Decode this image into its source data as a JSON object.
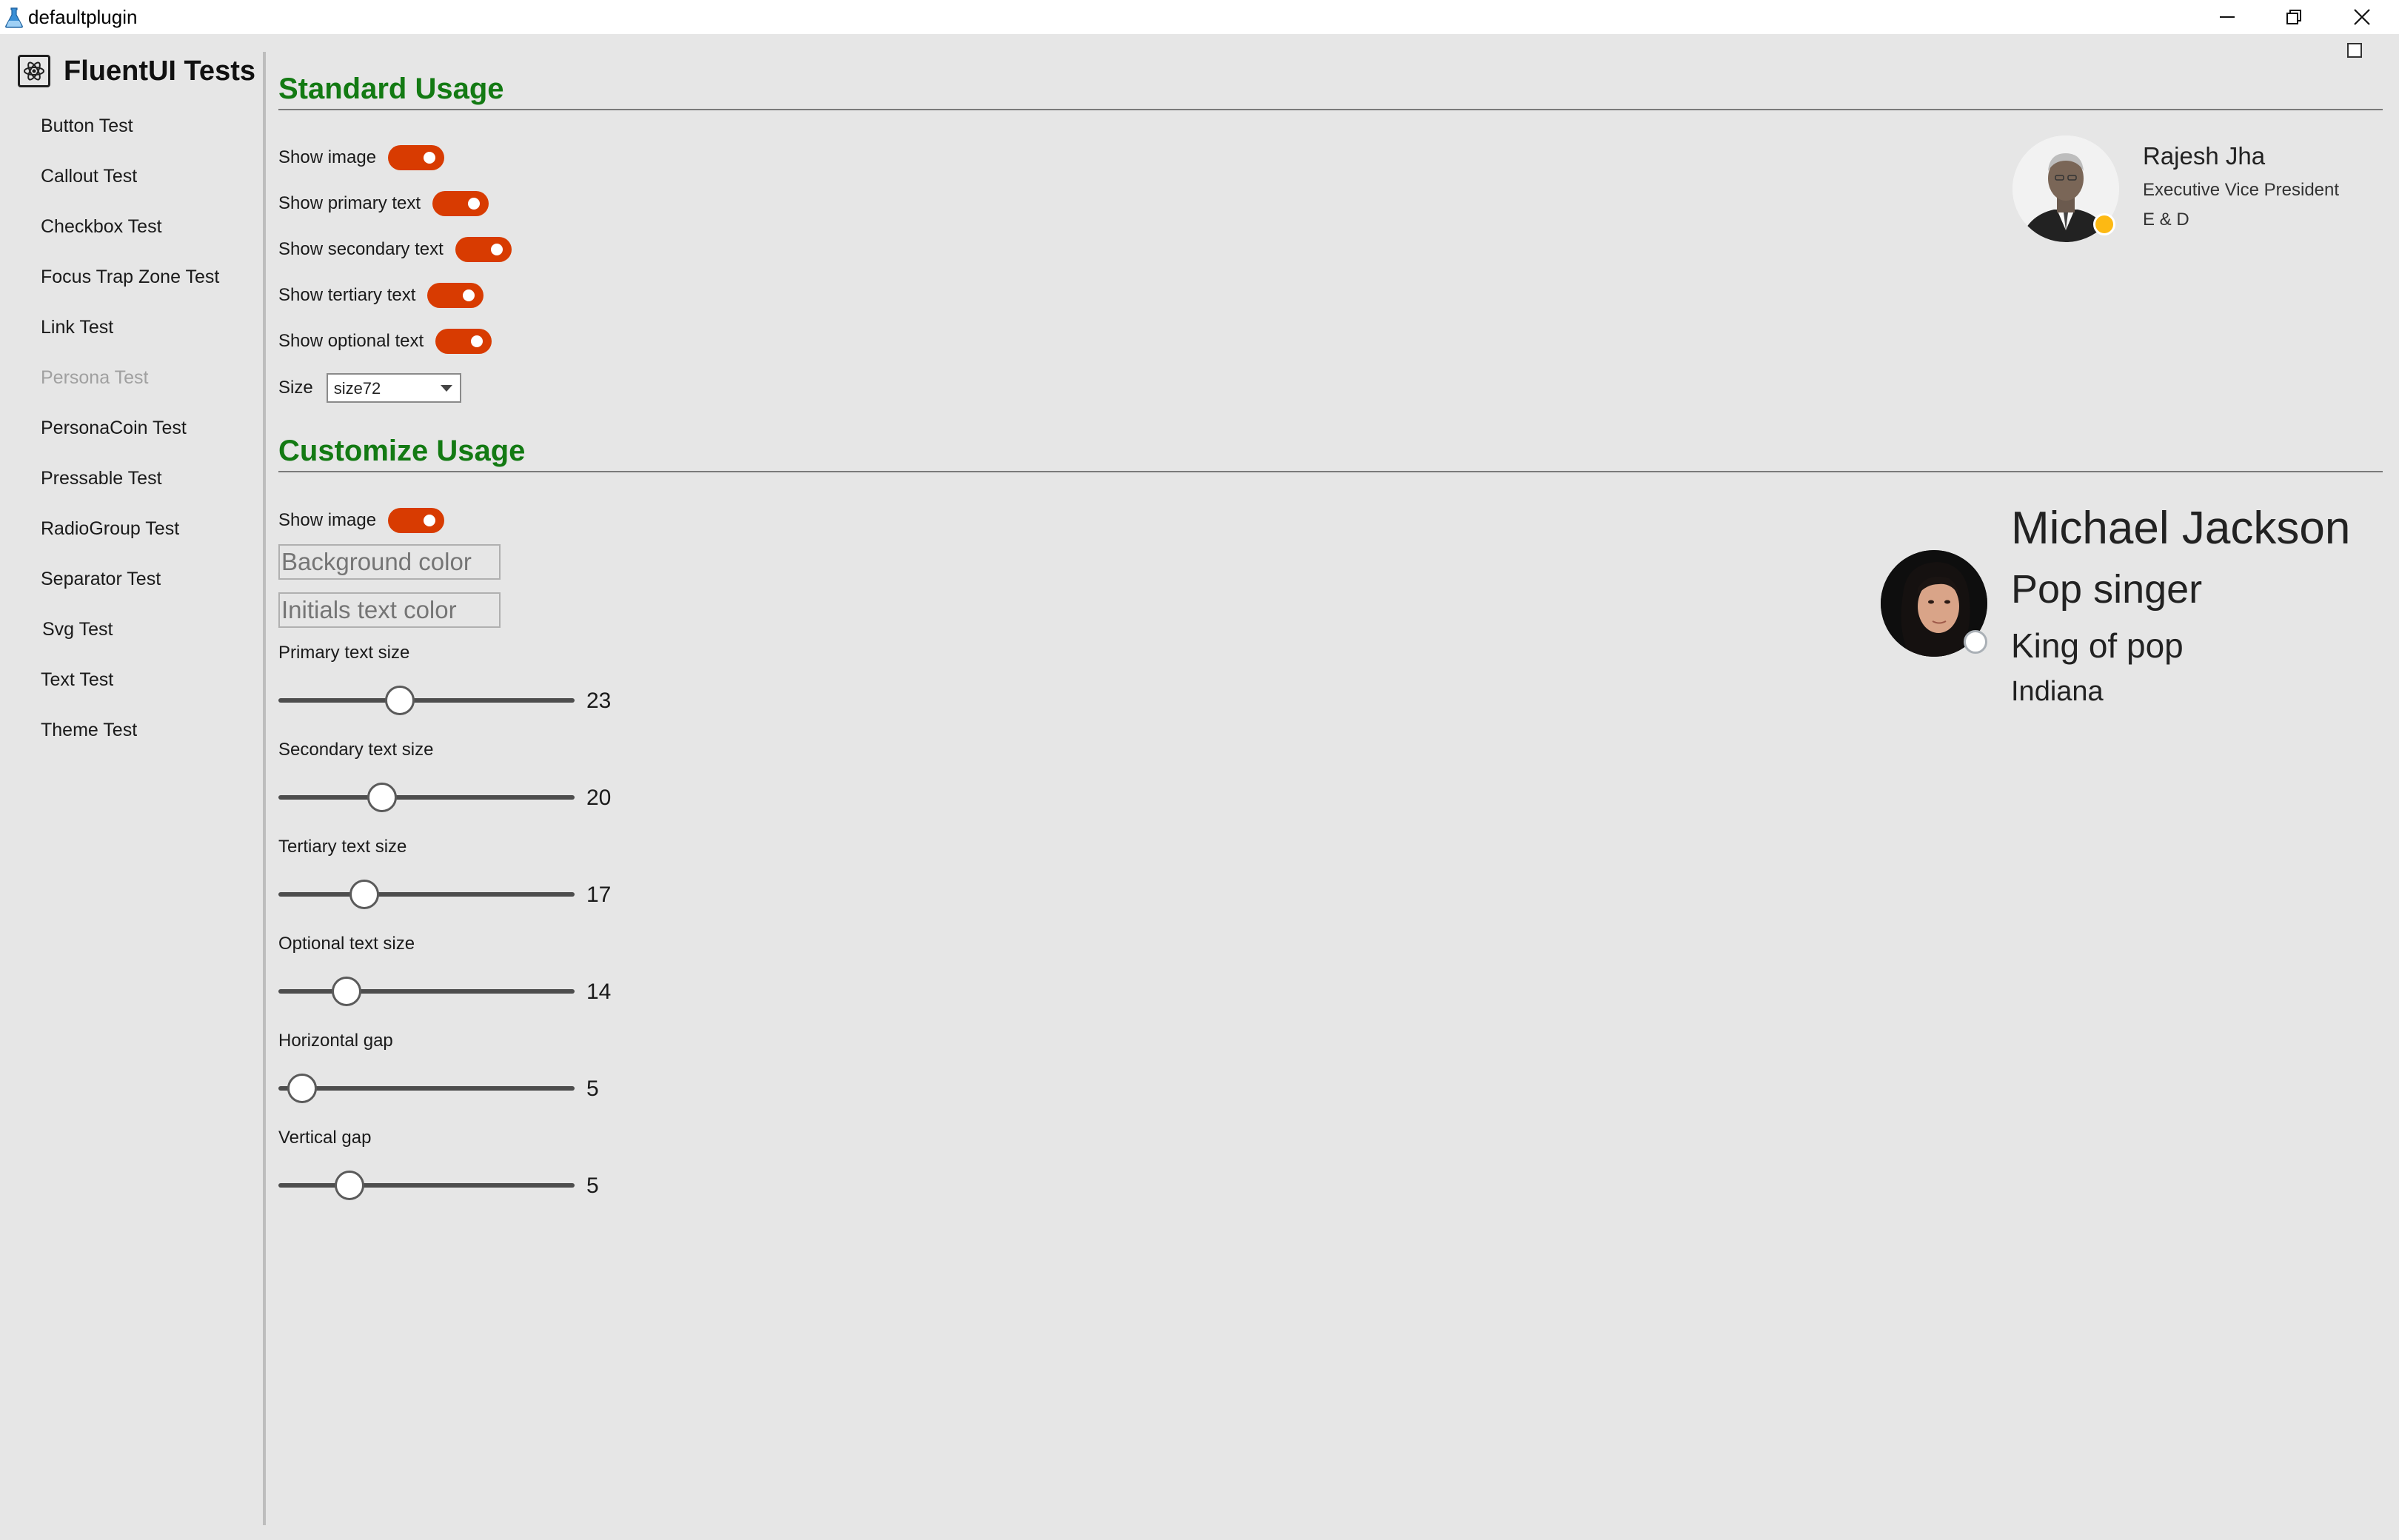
{
  "window": {
    "title": "defaultplugin"
  },
  "sidebar": {
    "title": "FluentUI Tests",
    "items": [
      {
        "label": "Button Test",
        "disabled": false
      },
      {
        "label": "Callout Test",
        "disabled": false
      },
      {
        "label": "Checkbox Test",
        "disabled": false
      },
      {
        "label": "Focus Trap Zone Test",
        "disabled": false
      },
      {
        "label": "Link Test",
        "disabled": false
      },
      {
        "label": "Persona Test",
        "disabled": true
      },
      {
        "label": "PersonaCoin Test",
        "disabled": false
      },
      {
        "label": "Pressable Test",
        "disabled": false
      },
      {
        "label": "RadioGroup Test",
        "disabled": false
      },
      {
        "label": "Separator Test",
        "disabled": false
      },
      {
        "label": "Svg Test",
        "disabled": false
      },
      {
        "label": "Text Test",
        "disabled": false
      },
      {
        "label": "Theme Test",
        "disabled": false
      }
    ]
  },
  "standard": {
    "title": "Standard Usage",
    "toggles": [
      {
        "label": "Show image",
        "on": true
      },
      {
        "label": "Show primary text",
        "on": true
      },
      {
        "label": "Show secondary text",
        "on": true
      },
      {
        "label": "Show tertiary text",
        "on": true
      },
      {
        "label": "Show optional text",
        "on": true
      }
    ],
    "size_label": "Size",
    "size_value": "size72",
    "persona": {
      "name": "Rajesh Jha",
      "secondary": "Executive Vice President",
      "tertiary": "E & D",
      "presence": "away"
    }
  },
  "customize": {
    "title": "Customize Usage",
    "show_image_label": "Show image",
    "show_image_on": true,
    "background_color_placeholder": "Background color",
    "initials_color_placeholder": "Initials text color",
    "sliders": [
      {
        "label": "Primary text size",
        "value": "23",
        "fraction": 0.41
      },
      {
        "label": "Secondary text size",
        "value": "20",
        "fraction": 0.35
      },
      {
        "label": "Tertiary text size",
        "value": "17",
        "fraction": 0.29
      },
      {
        "label": "Optional text size",
        "value": "14",
        "fraction": 0.23
      },
      {
        "label": "Horizontal gap",
        "value": "5",
        "fraction": 0.08
      },
      {
        "label": "Vertical gap",
        "value": "5",
        "fraction": 0.24
      }
    ],
    "persona": {
      "name": "Michael Jackson",
      "secondary": "Pop singer",
      "tertiary": "King of pop",
      "optional": "Indiana",
      "presence": "offline"
    }
  },
  "colors": {
    "accent": "#d83b01",
    "section_title": "#137a13",
    "background": "#e6e6e6"
  }
}
